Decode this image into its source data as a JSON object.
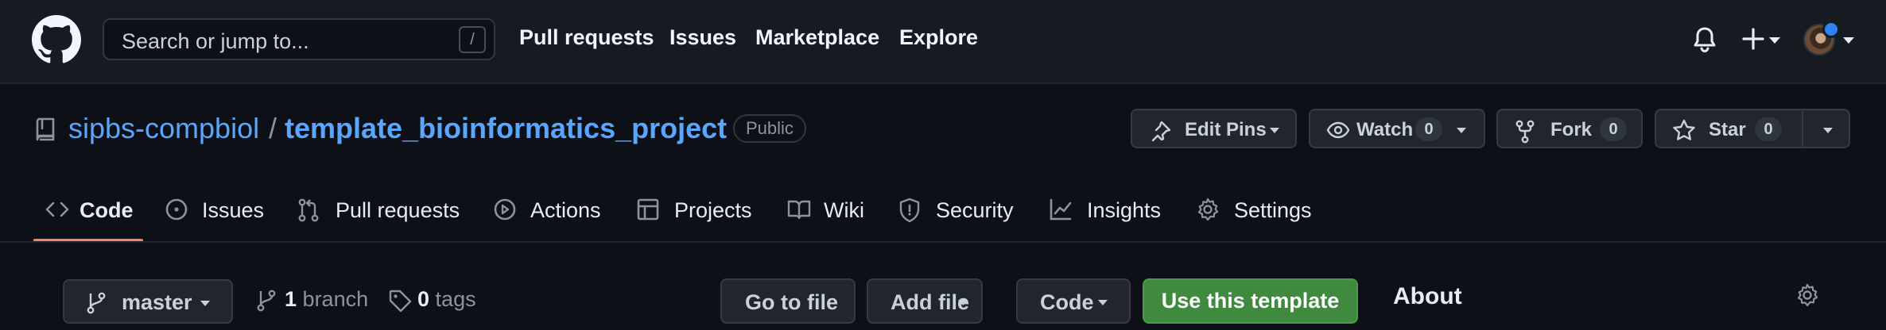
{
  "header": {
    "search_placeholder": "Search or jump to...",
    "search_shortcut": "/",
    "nav": [
      "Pull requests",
      "Issues",
      "Marketplace",
      "Explore"
    ]
  },
  "repo": {
    "owner": "sipbs-compbiol",
    "separator": "/",
    "name": "template_bioinformatics_project",
    "visibility": "Public",
    "actions": {
      "edit_pins_label": "Edit Pins",
      "watch_label": "Watch",
      "watch_count": "0",
      "fork_label": "Fork",
      "fork_count": "0",
      "star_label": "Star",
      "star_count": "0"
    }
  },
  "tabs": [
    "Code",
    "Issues",
    "Pull requests",
    "Actions",
    "Projects",
    "Wiki",
    "Security",
    "Insights",
    "Settings"
  ],
  "file_nav": {
    "branch": "master",
    "branch_count": "1",
    "branch_label": "branch",
    "tag_count": "0",
    "tag_label": "tags",
    "go_to_file": "Go to file",
    "add_file": "Add file",
    "code": "Code",
    "use_template": "Use this template",
    "about": "About"
  },
  "colors": {
    "accent_link": "#58a6ff",
    "tab_underline": "#f78166",
    "template_button": "#3f8a3f",
    "notification_dot": "#2f81f7"
  }
}
